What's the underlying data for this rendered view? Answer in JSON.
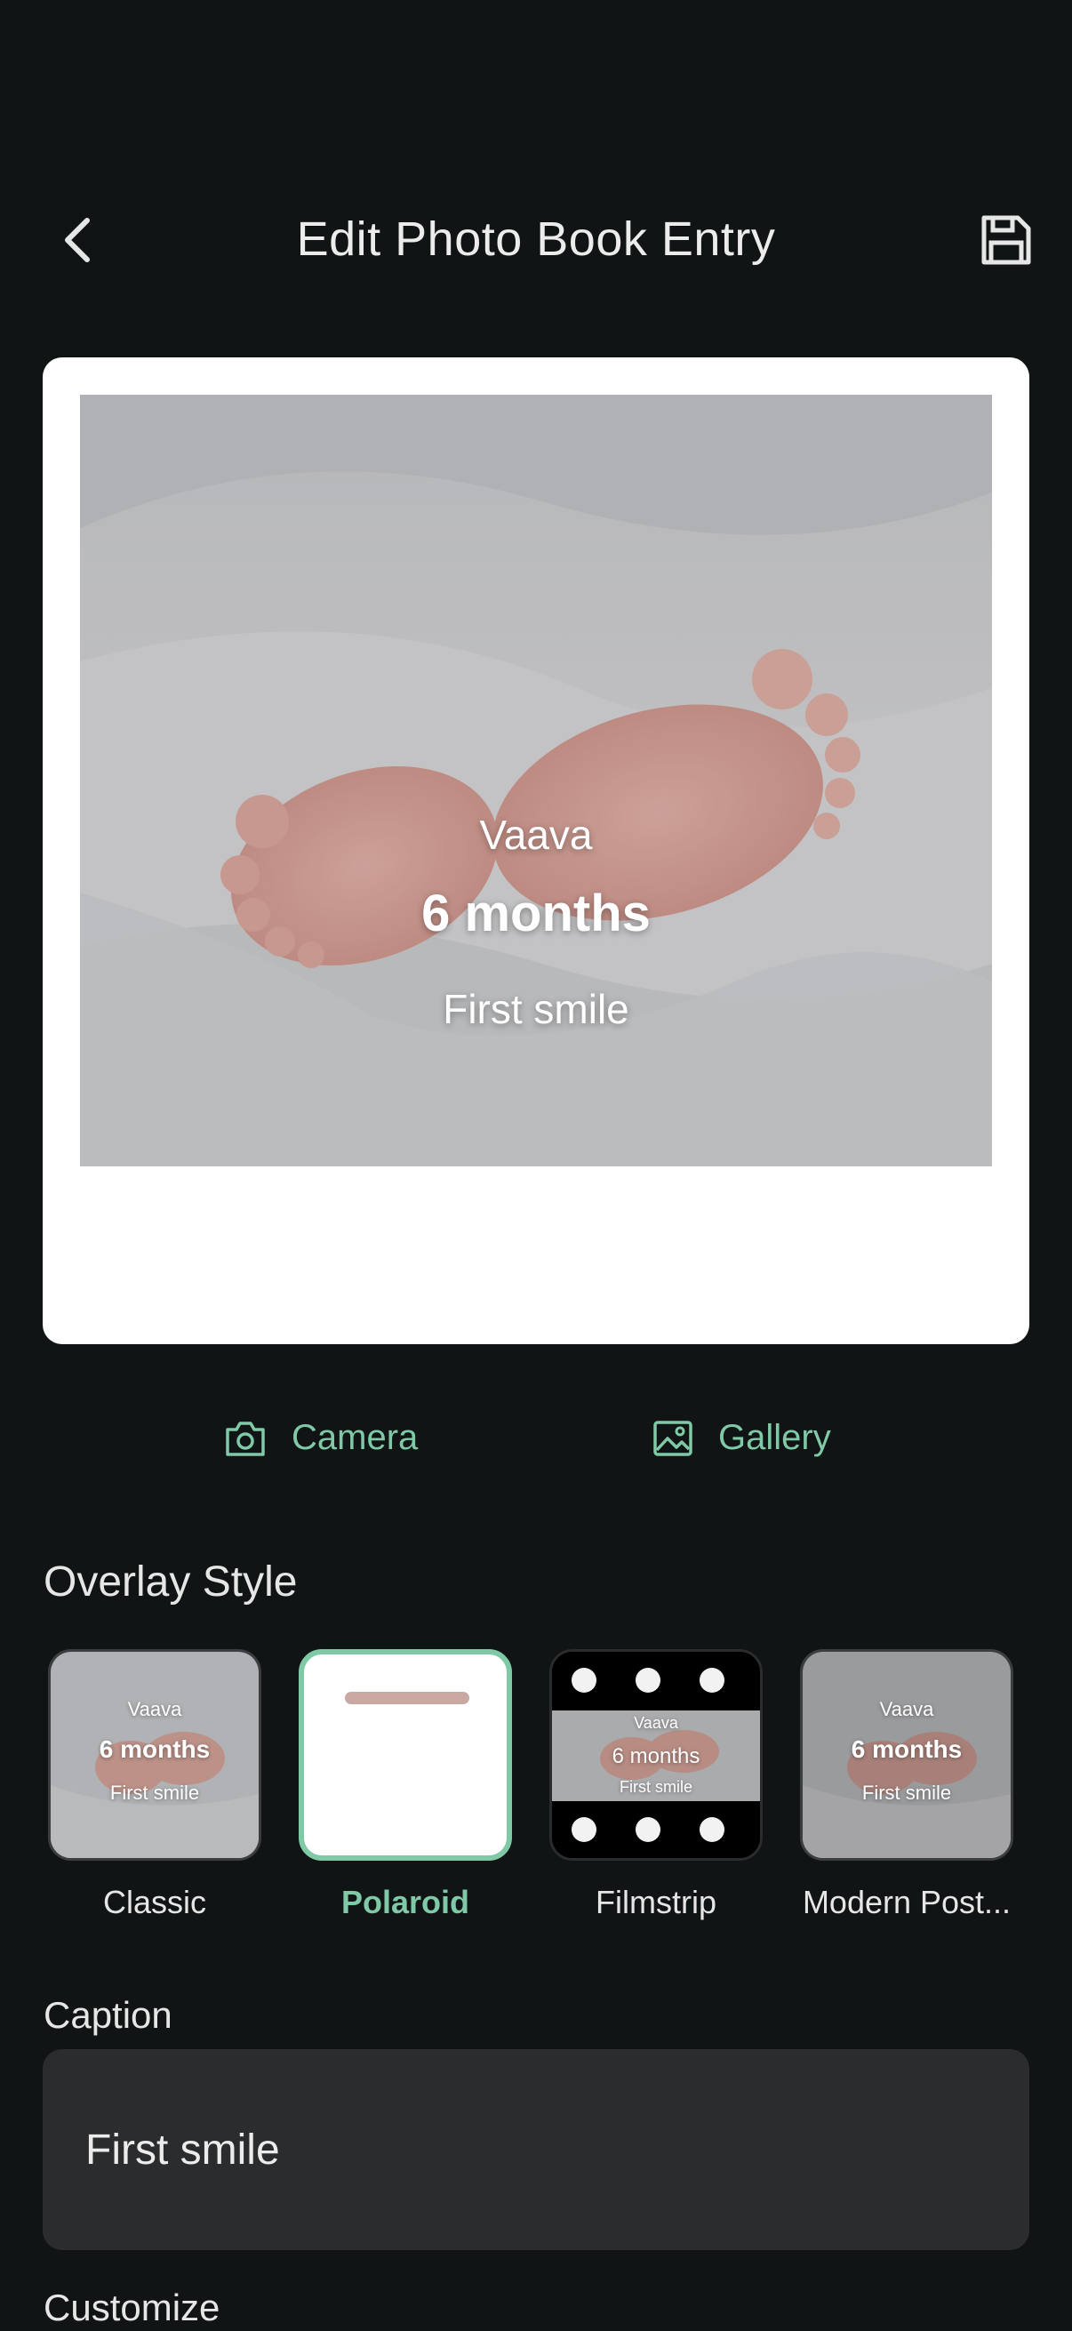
{
  "header": {
    "title": "Edit Photo Book Entry",
    "back_icon": "chevron-left-icon",
    "save_icon": "floppy-disk-icon"
  },
  "preview": {
    "name": "Vaava",
    "age": "6 months",
    "caption": "First smile"
  },
  "source": {
    "camera_label": "Camera",
    "gallery_label": "Gallery"
  },
  "overlay_style": {
    "label": "Overlay Style",
    "selected": "Polaroid",
    "options": [
      {
        "label": "Classic"
      },
      {
        "label": "Polaroid"
      },
      {
        "label": "Filmstrip"
      },
      {
        "label": "Modern Post..."
      }
    ],
    "thumb_name": "Vaava",
    "thumb_age": "6 months",
    "thumb_caption": "First smile"
  },
  "caption": {
    "label": "Caption",
    "value": "First smile"
  },
  "customize": {
    "label": "Customize"
  },
  "colors": {
    "background": "#111415",
    "accent": "#7fc9a7",
    "input_bg": "#2a2c2e"
  }
}
